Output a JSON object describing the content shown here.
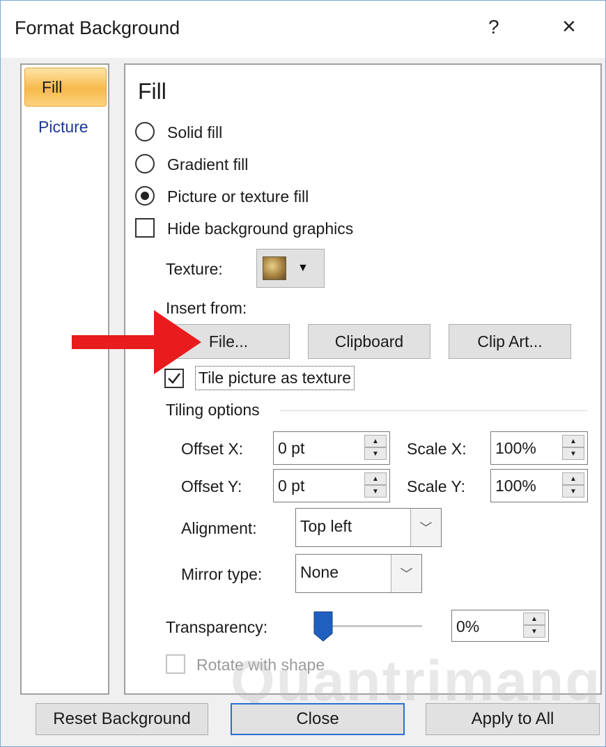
{
  "window": {
    "title": "Format Background",
    "help_glyph": "?",
    "close_glyph": "×"
  },
  "nav": {
    "items": [
      "Fill",
      "Picture"
    ],
    "selected": "Fill",
    "selected_color": "#f7b94a"
  },
  "fill": {
    "heading": "Fill",
    "options": [
      {
        "label": "Solid fill",
        "selected": false
      },
      {
        "label": "Gradient fill",
        "selected": false
      },
      {
        "label": "Picture or texture fill",
        "selected": true
      }
    ],
    "hide_graphics": {
      "label": "Hide background graphics",
      "checked": false
    },
    "texture_label": "Texture:",
    "texture_arrow": "▼",
    "insert_from": {
      "label": "Insert from:",
      "buttons": [
        "File...",
        "Clipboard",
        "Clip Art..."
      ]
    },
    "tile": {
      "label": "Tile picture as texture",
      "checked": true
    },
    "tiling": {
      "heading": "Tiling options",
      "offset_x": {
        "label": "Offset X:",
        "value": "0 pt"
      },
      "offset_y": {
        "label": "Offset Y:",
        "value": "0 pt"
      },
      "scale_x": {
        "label": "Scale X:",
        "value": "100%"
      },
      "scale_y": {
        "label": "Scale Y:",
        "value": "100%"
      },
      "alignment": {
        "label": "Alignment:",
        "value": "Top left"
      },
      "mirror": {
        "label": "Mirror type:",
        "value": "None"
      }
    },
    "transparency": {
      "label": "Transparency:",
      "value": "0%",
      "level": 0
    },
    "rotate": {
      "label": "Rotate with shape",
      "checked": false,
      "enabled": false
    }
  },
  "footer": {
    "reset": "Reset Background",
    "close": "Close",
    "apply_all": "Apply to All"
  },
  "annotation": {
    "arrow_color": "#e81c1c"
  },
  "watermark": "Quantrimang"
}
